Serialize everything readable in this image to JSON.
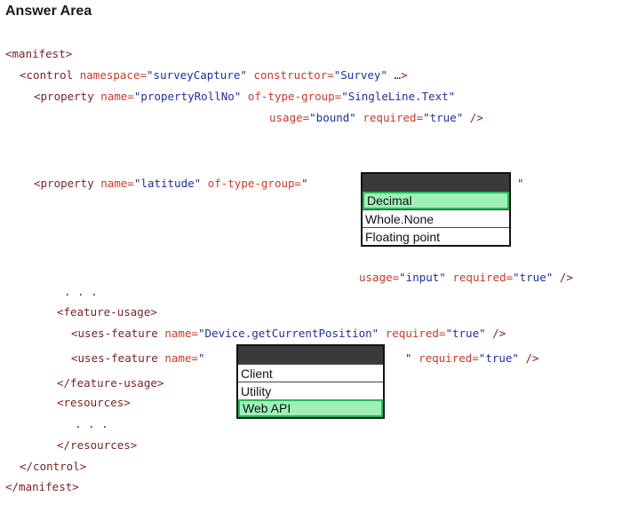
{
  "title": "Answer Area",
  "code": {
    "manifest_open": "<manifest>",
    "control_tag": "<control",
    "control_attr1": "namespace=",
    "control_val1": "\"surveyCapture\"",
    "control_attr2": "constructor=",
    "control_val2": "\"Survey\"",
    "control_end": " …>",
    "prop1_tag": "<property",
    "prop1_attr1": "name=",
    "prop1_val1": "\"propertyRollNo\"",
    "prop1_attr2": "of-type-group=",
    "prop1_val2": "\"SingleLine.Text\"",
    "prop1_attr3": "usage=",
    "prop1_val3": "\"bound\"",
    "prop1_attr4": "required=",
    "prop1_val4": "\"true\"",
    "prop1_close": " />",
    "prop2_tag": "<property",
    "prop2_attr1": "name=",
    "prop2_val1": "\"latitude\"",
    "prop2_attr2": "of-type-group=",
    "prop2_quote_open": "\"",
    "prop2_quote_close": "\"",
    "prop2_attr3": "usage=",
    "prop2_val3": "\"input\"",
    "prop2_attr4": "required=",
    "prop2_val4": "\"true\"",
    "prop2_close": " />",
    "dots1": ". . .",
    "feature_open": "<feature-usage>",
    "uf1_tag": "<uses-feature",
    "uf1_attr1": "name=",
    "uf1_val1": "\"Device.getCurrentPosition\"",
    "uf1_attr2": "required=",
    "uf1_val2": "\"true\"",
    "uf1_close": " />",
    "uf2_tag": "<uses-feature",
    "uf2_attr1": "name=",
    "uf2_quote_open": "\"",
    "uf2_quote_close": "\"",
    "uf2_attr2": "required=",
    "uf2_val2": "\"true\"",
    "uf2_close": " />",
    "feature_close": "</feature-usage>",
    "resources_open": "<resources>",
    "dots2": ". . .",
    "resources_close": "</resources>",
    "control_close": "</control>",
    "manifest_close": "</manifest>"
  },
  "dropdown1": {
    "options": [
      "Decimal",
      "Whole.None",
      "Floating point"
    ],
    "selected": "Decimal"
  },
  "dropdown2": {
    "options": [
      "Client",
      "Utility",
      "Web API"
    ],
    "selected": "Web API"
  },
  "colors": {
    "selected_fill": "#9ff0b8",
    "selected_border": "#27b85a",
    "header": "#3a3a3a"
  }
}
